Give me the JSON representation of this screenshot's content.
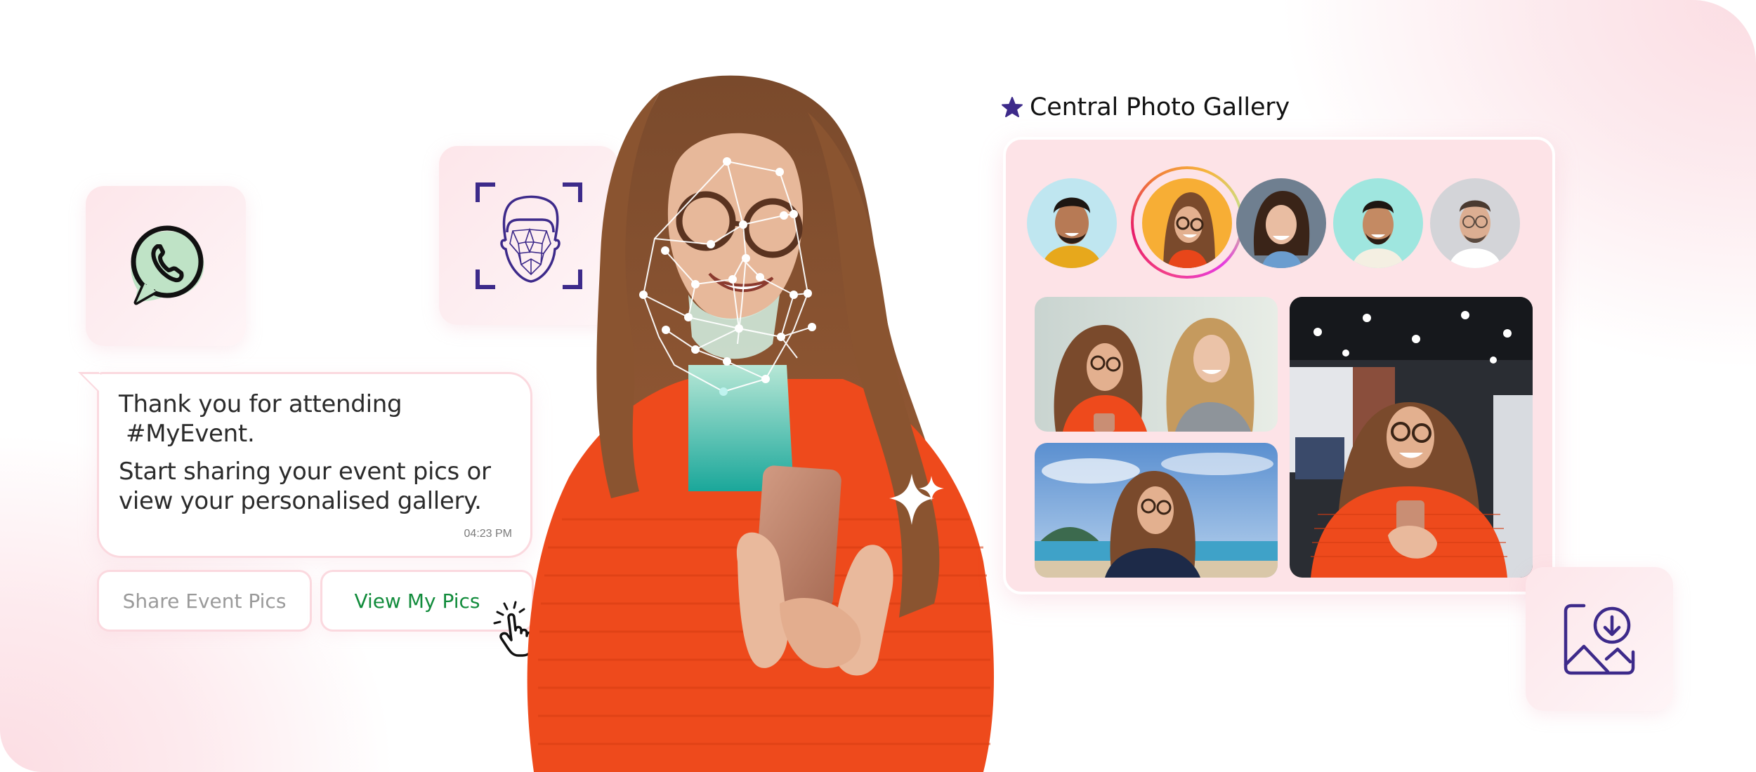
{
  "scene": {
    "description": "Event photo-sharing hero illustration",
    "accent_color": "#3d2a8a",
    "whatsapp_green": "#128c3c",
    "tile_color": "#fde6ea"
  },
  "icons": {
    "whatsapp": "whatsapp-icon",
    "face_scan": "face-recognition-icon",
    "download_image": "image-download-icon",
    "sparkle": "sparkle-icon",
    "cursor": "pointer-hand-icon",
    "star": "star-icon"
  },
  "chat": {
    "line1": "Thank you for attending",
    "hashtag": "#MyEvent.",
    "line2": "Start sharing your event pics or view your personalised gallery.",
    "time": "04:23 PM",
    "buttons": [
      {
        "label": "Share Event Pics",
        "state": "default"
      },
      {
        "label": "View My Pics",
        "state": "hovered"
      }
    ]
  },
  "gallery": {
    "title": "Central Photo Gallery",
    "avatars": [
      {
        "name": "person-1",
        "bg": "#bfe6f0",
        "selected": false
      },
      {
        "name": "person-2",
        "bg": "#f7ae35",
        "selected": true
      },
      {
        "name": "person-3",
        "bg": "#6f7f90",
        "selected": false
      },
      {
        "name": "person-4",
        "bg": "#9fe6df",
        "selected": false
      },
      {
        "name": "person-5",
        "bg": "#d3d4d8",
        "selected": false
      }
    ],
    "photos": [
      {
        "scene": "two friends at event"
      },
      {
        "scene": "beach portrait"
      },
      {
        "scene": "expo hall with phone"
      }
    ]
  }
}
